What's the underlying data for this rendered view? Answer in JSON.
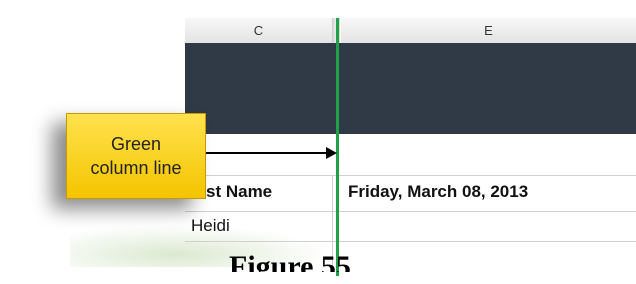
{
  "columns": {
    "c": "C",
    "e": "E"
  },
  "callout": {
    "line1": "Green",
    "line2": "column line"
  },
  "rows": {
    "header_name": "st Name",
    "header_date": "Friday, March 08, 2013",
    "first_name": "Heidi"
  },
  "caption": "Figure 55",
  "colors": {
    "green_line": "#21a04a",
    "banner": "#2f3a46",
    "callout": "#f4c400"
  }
}
